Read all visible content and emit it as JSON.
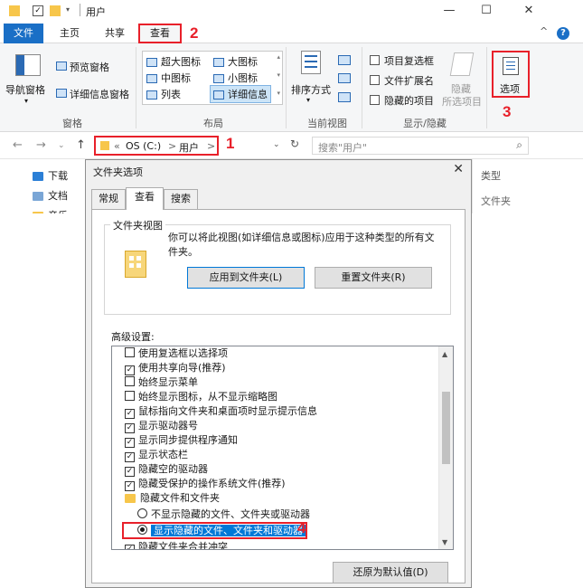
{
  "window": {
    "title": "用户",
    "minimize": "—",
    "maximize": "☐",
    "close": "✕"
  },
  "ribbon": {
    "tabs": {
      "file": "文件",
      "home": "主页",
      "share": "共享",
      "view": "查看"
    },
    "collapse": "^",
    "help": "?",
    "panes": {
      "nav_pane": "导航窗格",
      "preview": "预览窗格",
      "details": "详细信息窗格",
      "group_label": "窗格"
    },
    "layout": {
      "items": [
        "超大图标",
        "大图标",
        "中图标",
        "小图标",
        "列表",
        "详细信息"
      ],
      "group_label": "布局"
    },
    "current_view": {
      "sort": "排序方式",
      "group_label": "当前视图"
    },
    "show_hide": {
      "item_checkbox": "项目复选框",
      "file_ext": "文件扩展名",
      "hidden_items": "隐藏的项目",
      "hide_selected_1": "隐藏",
      "hide_selected_2": "所选项目",
      "group_label": "显示/隐藏"
    },
    "options": "选项"
  },
  "annotations": {
    "n1": "1",
    "n2": "2",
    "n3": "3",
    "n4": "4"
  },
  "address": {
    "prefix": "«",
    "drive": "OS (C:)",
    "sep": ">",
    "folder": "用户",
    "search_placeholder": "搜索\"用户\""
  },
  "nav_pane": {
    "items": [
      "下载",
      "文档",
      "音乐"
    ]
  },
  "right_col": {
    "header": "类型",
    "value": "文件夹"
  },
  "dialog": {
    "title": "文件夹选项",
    "close": "✕",
    "tabs": [
      "常规",
      "查看",
      "搜索"
    ],
    "folder_view": {
      "title": "文件夹视图",
      "desc": "你可以将此视图(如详细信息或图标)应用于这种类型的所有文件夹。",
      "apply": "应用到文件夹(L)",
      "reset": "重置文件夹(R)"
    },
    "advanced_label": "高级设置:",
    "advanced": [
      {
        "kind": "check",
        "checked": false,
        "label": "使用复选框以选择项"
      },
      {
        "kind": "check",
        "checked": true,
        "label": "使用共享向导(推荐)"
      },
      {
        "kind": "check",
        "checked": false,
        "label": "始终显示菜单"
      },
      {
        "kind": "check",
        "checked": false,
        "label": "始终显示图标，从不显示缩略图"
      },
      {
        "kind": "check",
        "checked": true,
        "label": "鼠标指向文件夹和桌面项时显示提示信息"
      },
      {
        "kind": "check",
        "checked": true,
        "label": "显示驱动器号"
      },
      {
        "kind": "check",
        "checked": true,
        "label": "显示同步提供程序通知"
      },
      {
        "kind": "check",
        "checked": true,
        "label": "显示状态栏"
      },
      {
        "kind": "check",
        "checked": true,
        "label": "隐藏空的驱动器"
      },
      {
        "kind": "check",
        "checked": true,
        "label": "隐藏受保护的操作系统文件(推荐)"
      },
      {
        "kind": "folder",
        "label": "隐藏文件和文件夹"
      },
      {
        "kind": "radio",
        "checked": false,
        "label": "不显示隐藏的文件、文件夹或驱动器"
      },
      {
        "kind": "radio",
        "checked": true,
        "label": "显示隐藏的文件、文件夹和驱动器"
      },
      {
        "kind": "check",
        "checked": true,
        "label": "隐藏文件夹合并冲突"
      }
    ],
    "restore_defaults": "还原为默认值(D)"
  },
  "colors": {
    "accent": "#1a6fc6",
    "annotation": "#e8202a",
    "selection": "#0078d7"
  }
}
